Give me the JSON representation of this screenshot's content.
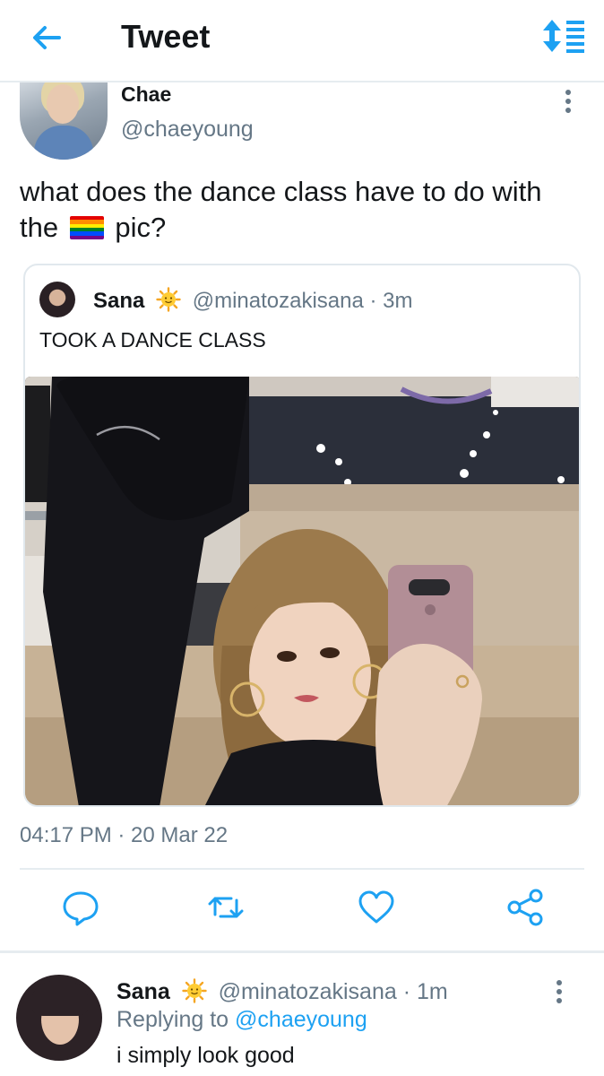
{
  "header": {
    "title": "Tweet",
    "back_icon": "arrow-left-icon",
    "sort_icon": "sort-icon"
  },
  "main_tweet": {
    "name": "Chae",
    "handle": "@chaeyoung",
    "text_before_emoji": "what does the dance class have to do with the",
    "emoji": "rainbow-flag",
    "text_after_emoji": "pic?",
    "timestamp": "04:17 PM · 20 Mar 22"
  },
  "quoted_tweet": {
    "name": "Sana",
    "emoji": "sun-with-face",
    "handle": "@minatozakisana · 3m",
    "text": "TOOK A DANCE CLASS"
  },
  "actions": {
    "reply_icon": "reply-icon",
    "retweet_icon": "retweet-icon",
    "like_icon": "heart-icon",
    "share_icon": "share-icon"
  },
  "reply": {
    "name": "Sana",
    "emoji": "sun-with-face",
    "handle": "@minatozakisana · 1m",
    "replying_prefix": "Replying to",
    "replying_handle": "@chaeyoung",
    "text": "i simply look good"
  },
  "colors": {
    "accent": "#1da1f2",
    "text_primary": "#14171a",
    "text_secondary": "#657786",
    "divider": "#e6ecf0"
  }
}
